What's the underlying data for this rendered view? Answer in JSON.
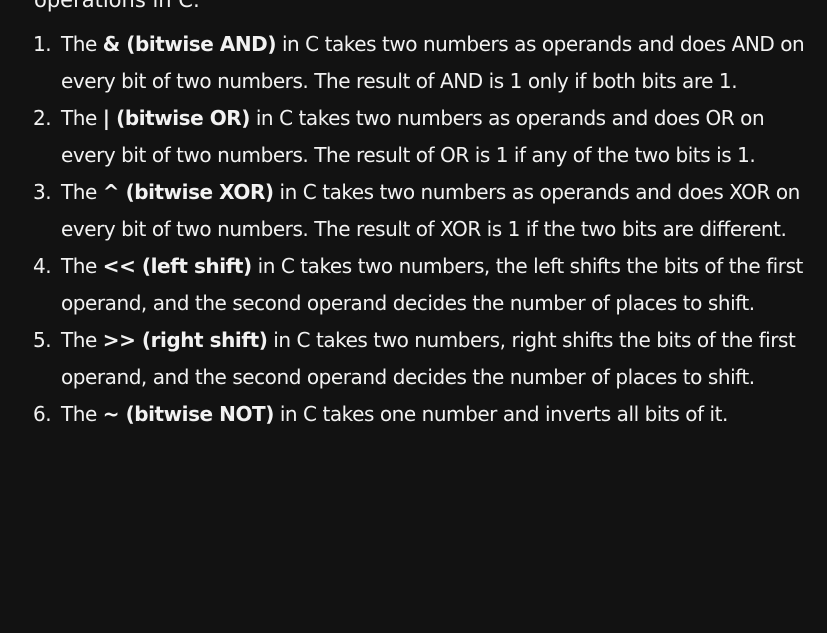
{
  "cutoff_heading": "operations in C:",
  "items": [
    {
      "number": "1.",
      "pre": "The ",
      "op": "& (bitwise AND)",
      "post": " in C takes two numbers as operands and does AND on every bit of two numbers. The result of AND is 1 only if both bits are 1."
    },
    {
      "number": "2.",
      "pre": "The ",
      "op": "| (bitwise OR)",
      "post": " in C takes two numbers as operands and does OR on every bit of two numbers. The result of OR is 1 if any of the two bits is 1."
    },
    {
      "number": "3.",
      "pre": "The ",
      "op": "^ (bitwise XOR)",
      "post": " in C takes two numbers as operands and does XOR on every bit of two numbers. The result of XOR is 1 if the two bits are different."
    },
    {
      "number": "4.",
      "pre": "The ",
      "op": "<< (left shift)",
      "post": " in C takes two numbers, the left shifts the bits of the first operand, and the second operand decides the number of places to shift."
    },
    {
      "number": "5.",
      "pre": "The ",
      "op": ">> (right shift)",
      "post": " in C takes two numbers, right shifts the bits of the first operand, and the second operand decides the number of places to shift."
    },
    {
      "number": "6.",
      "pre": "The ",
      "op": "~ (bitwise NOT)",
      "post": " in C takes one number and inverts all bits of it."
    }
  ]
}
